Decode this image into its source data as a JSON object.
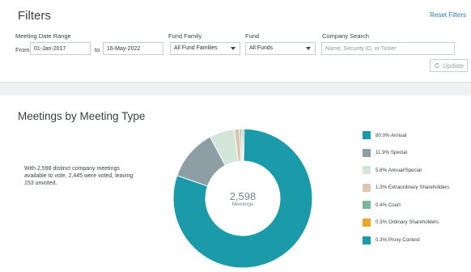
{
  "filters": {
    "title": "Filters",
    "reset_label": "Reset Filters",
    "date_range": {
      "label": "Meeting Date Range",
      "from_label": "From",
      "from_value": "01-Jan-2017",
      "to_label": "to",
      "to_value": "16-May-2022"
    },
    "fund_family": {
      "label": "Fund Family",
      "value": "All Fund Families"
    },
    "fund": {
      "label": "Fund",
      "value": "All Funds"
    },
    "company_search": {
      "label": "Company Search",
      "placeholder": "Name, Security ID, or Ticker",
      "value": ""
    },
    "update_label": "Update",
    "update_icon": "refresh-icon"
  },
  "meetings": {
    "title": "Meetings by Meeting Type",
    "summary": "With 2,598 distinct company meetings available to vote, 2,445 were voted, leaving 153 unvoted.",
    "total_label": "2,598",
    "total_caption": "Meetings"
  },
  "chart_data": {
    "type": "pie",
    "variant": "donut",
    "center_value": "2,598",
    "center_label": "Meetings",
    "legend_position": "right",
    "slices": [
      {
        "label": "80.0% Annual",
        "value": 80.0,
        "color": "#1b9aaa"
      },
      {
        "label": "11.9% Special",
        "value": 11.9,
        "color": "#8e9ea5"
      },
      {
        "label": "5.8% Annual/Special",
        "value": 5.8,
        "color": "#d2e5d8"
      },
      {
        "label": "1.3% Extraordinary Shareholders",
        "value": 1.3,
        "color": "#dcc7b2"
      },
      {
        "label": "0.4% Court",
        "value": 0.4,
        "color": "#79b79b"
      },
      {
        "label": "0.3% Ordinary Shareholders",
        "value": 0.3,
        "color": "#e8a62a"
      },
      {
        "label": "0.3% Proxy Contest",
        "value": 0.3,
        "color": "#1b9aaa"
      }
    ]
  }
}
